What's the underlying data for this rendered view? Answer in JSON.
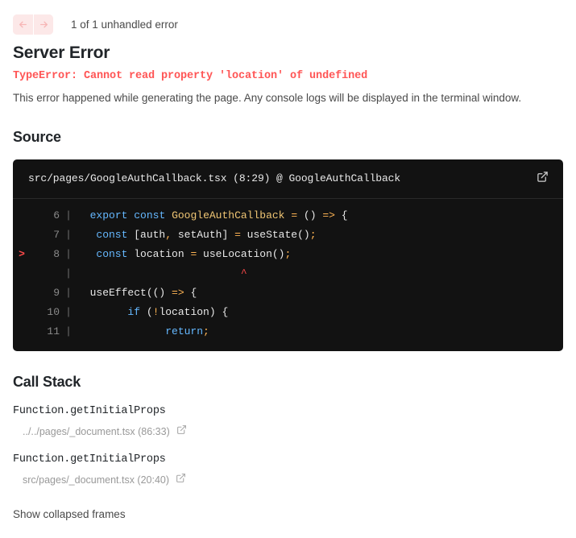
{
  "nav": {
    "back_icon": "arrow-left-icon",
    "forward_icon": "arrow-right-icon",
    "count_label": "1 of 1 unhandled error"
  },
  "error": {
    "title": "Server Error",
    "message": "TypeError: Cannot read property 'location' of undefined",
    "description": "This error happened while generating the page. Any console logs will be displayed in the terminal window."
  },
  "source": {
    "heading": "Source",
    "file_path": "src/pages/GoogleAuthCallback.tsx (8:29) @ GoogleAuthCallback",
    "open_icon": "external-link-icon",
    "lines": [
      {
        "marker": "",
        "number": "6",
        "pipe": "|",
        "tokens": [
          {
            "text": "  ",
            "cls": "t-pl"
          },
          {
            "text": "export",
            "cls": "t-kw"
          },
          {
            "text": " ",
            "cls": "t-pl"
          },
          {
            "text": "const",
            "cls": "t-kw"
          },
          {
            "text": " ",
            "cls": "t-pl"
          },
          {
            "text": "GoogleAuthCallback",
            "cls": "t-fn"
          },
          {
            "text": " ",
            "cls": "t-pl"
          },
          {
            "text": "=",
            "cls": "t-op"
          },
          {
            "text": " () ",
            "cls": "t-pl"
          },
          {
            "text": "=>",
            "cls": "t-op"
          },
          {
            "text": " {",
            "cls": "t-pl"
          }
        ]
      },
      {
        "marker": "",
        "number": "7",
        "pipe": "|",
        "tokens": [
          {
            "text": "   ",
            "cls": "t-pl"
          },
          {
            "text": "const",
            "cls": "t-kw"
          },
          {
            "text": " [auth",
            "cls": "t-pl"
          },
          {
            "text": ",",
            "cls": "t-op"
          },
          {
            "text": " setAuth] ",
            "cls": "t-pl"
          },
          {
            "text": "=",
            "cls": "t-op"
          },
          {
            "text": " useState()",
            "cls": "t-pl"
          },
          {
            "text": ";",
            "cls": "t-op"
          }
        ]
      },
      {
        "marker": ">",
        "number": "8",
        "pipe": "|",
        "tokens": [
          {
            "text": "   ",
            "cls": "t-pl"
          },
          {
            "text": "const",
            "cls": "t-kw"
          },
          {
            "text": " location ",
            "cls": "t-pl"
          },
          {
            "text": "=",
            "cls": "t-op"
          },
          {
            "text": " useLocation()",
            "cls": "t-pl"
          },
          {
            "text": ";",
            "cls": "t-op"
          }
        ]
      },
      {
        "marker": "",
        "number": "",
        "pipe": "|",
        "tokens": [
          {
            "text": "                          ",
            "cls": "t-pl"
          },
          {
            "text": "^",
            "cls": "t-caret"
          }
        ]
      },
      {
        "marker": "",
        "number": "9",
        "pipe": "|",
        "tokens": [
          {
            "text": "  useEffect(() ",
            "cls": "t-pl"
          },
          {
            "text": "=>",
            "cls": "t-op"
          },
          {
            "text": " {",
            "cls": "t-pl"
          }
        ]
      },
      {
        "marker": "",
        "number": "10",
        "pipe": "|",
        "tokens": [
          {
            "text": "        ",
            "cls": "t-pl"
          },
          {
            "text": "if",
            "cls": "t-kw"
          },
          {
            "text": " (",
            "cls": "t-pl"
          },
          {
            "text": "!",
            "cls": "t-op"
          },
          {
            "text": "location) {",
            "cls": "t-pl"
          }
        ]
      },
      {
        "marker": "",
        "number": "11",
        "pipe": "|",
        "tokens": [
          {
            "text": "              ",
            "cls": "t-pl"
          },
          {
            "text": "return",
            "cls": "t-kw"
          },
          {
            "text": ";",
            "cls": "t-op"
          }
        ]
      }
    ]
  },
  "call_stack": {
    "heading": "Call Stack",
    "entries": [
      {
        "function": "Function.getInitialProps",
        "location": "../../pages/_document.tsx (86:33)",
        "open_icon": "external-link-icon"
      },
      {
        "function": "Function.getInitialProps",
        "location": "src/pages/_document.tsx (20:40)",
        "open_icon": "external-link-icon"
      }
    ],
    "show_collapsed_label": "Show collapsed frames"
  },
  "colors": {
    "error_red": "#ff5555",
    "nav_bg": "#fce8e8",
    "code_bg": "#121212",
    "keyword_blue": "#65b8ff",
    "function_yellow": "#f0c674",
    "operator_orange": "#ffb454"
  }
}
